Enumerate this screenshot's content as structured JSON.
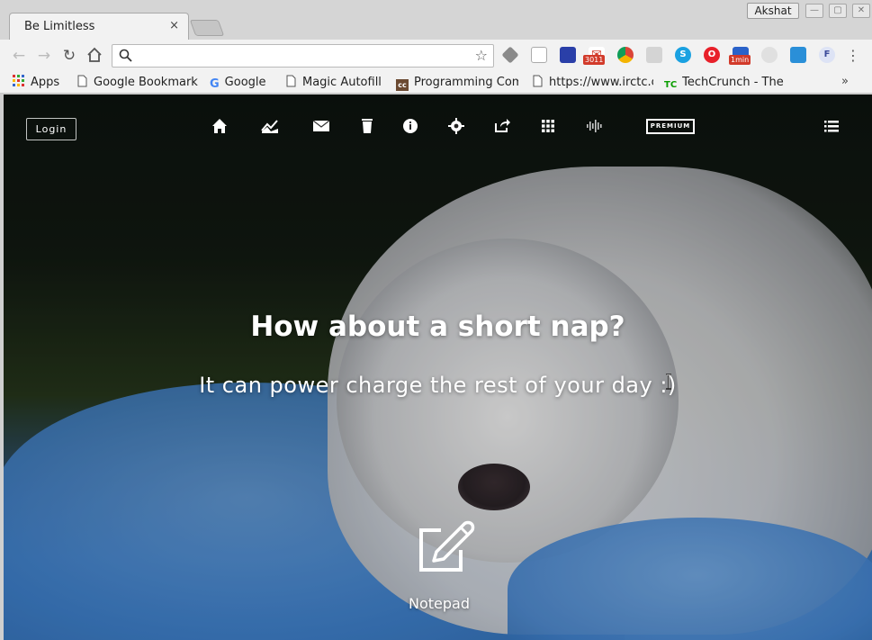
{
  "browser": {
    "tab": {
      "title": "Be Limitless",
      "close": "×"
    },
    "profile_name": "Akshat",
    "window_controls": {
      "minimize": "—",
      "maximize": "▢",
      "close": "✕"
    },
    "omnibox": {
      "value": "",
      "placeholder": ""
    },
    "extensions": [
      {
        "name": "layers-extension-icon"
      },
      {
        "name": "page-extension-icon"
      },
      {
        "name": "translate-extension-icon"
      },
      {
        "name": "gmail-extension-icon",
        "badge": "3011"
      },
      {
        "name": "chrome-extension-icon"
      },
      {
        "name": "gray-extension-icon"
      },
      {
        "name": "skype-extension-icon"
      },
      {
        "name": "opera-extension-icon"
      },
      {
        "name": "timer-extension-icon",
        "badge": "1min"
      },
      {
        "name": "disabled-extension-icon"
      },
      {
        "name": "sync-extension-icon"
      },
      {
        "name": "f-extension-icon",
        "label": "F"
      }
    ],
    "bookmarks": [
      {
        "label": "Apps",
        "icon": "apps-grid-icon"
      },
      {
        "label": "Google Bookmarks",
        "icon": "page-icon"
      },
      {
        "label": "Google",
        "icon": "google-icon"
      },
      {
        "label": "Magic Autofill",
        "icon": "page-icon"
      },
      {
        "label": "Programming Compilers",
        "icon": "cc-icon"
      },
      {
        "label": "https://www.irctc.co.in",
        "icon": "page-icon"
      },
      {
        "label": "TechCrunch - The latest",
        "icon": "techcrunch-icon"
      }
    ],
    "bookmarks_more": "»"
  },
  "app": {
    "login_label": "Login",
    "premium_label": "PREMIUM",
    "headline": "How about a short nap?",
    "subline": "It can power charge the rest of your day :)",
    "notepad_label": "Notepad"
  },
  "colors": {
    "accent_white": "#ffffff",
    "gmail_badge": "#d23a2a"
  }
}
